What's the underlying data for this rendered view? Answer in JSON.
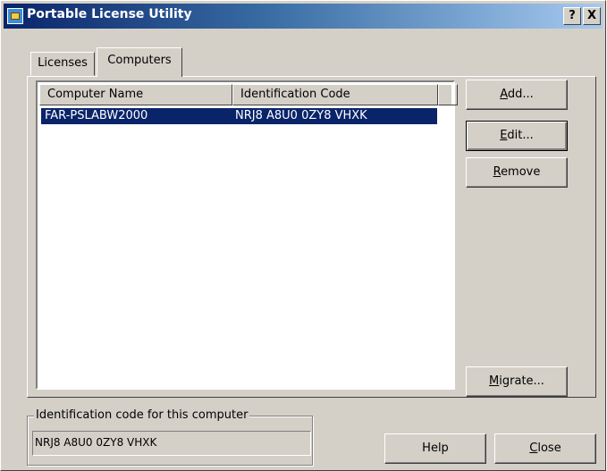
{
  "window": {
    "title": "Portable License Utility",
    "help_btn": "?",
    "close_btn": "X"
  },
  "tabs": [
    {
      "label": "Licenses",
      "selected": false
    },
    {
      "label": "Computers",
      "selected": true
    }
  ],
  "list": {
    "columns": [
      "Computer Name",
      "Identification Code"
    ],
    "rows": [
      {
        "computer_name": "FAR-PSLABW2000",
        "identification_code": "NRJ8 A8U0 0ZY8 VHXK",
        "selected": true
      }
    ]
  },
  "buttons": {
    "add": {
      "pre": "",
      "key": "A",
      "post": "dd..."
    },
    "edit": {
      "pre": "",
      "key": "E",
      "post": "dit..."
    },
    "remove": {
      "pre": "",
      "key": "R",
      "post": "emove"
    },
    "migrate": {
      "pre": "",
      "key": "M",
      "post": "igrate..."
    },
    "help": {
      "label": "Help"
    },
    "close": {
      "pre": "",
      "key": "C",
      "post": "lose"
    }
  },
  "id_group": {
    "label": "Identification code for this computer",
    "value": "NRJ8 A8U0 0ZY8 VHXK"
  },
  "colors": {
    "titlebar_start": "#0a246a",
    "titlebar_end": "#a6caf0",
    "face": "#d4d0c8",
    "selection": "#0a246a"
  }
}
